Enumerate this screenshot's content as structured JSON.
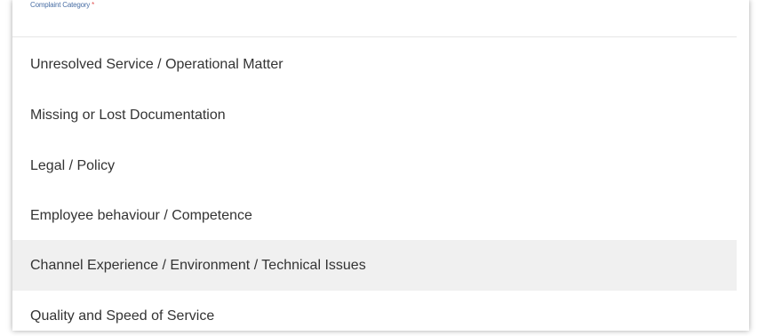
{
  "field": {
    "label": "Complaint Category",
    "required_marker": "*"
  },
  "dropdown": {
    "options": [
      {
        "label": "Unresolved Service / Operational Matter"
      },
      {
        "label": "Missing or Lost Documentation"
      },
      {
        "label": "Legal / Policy"
      },
      {
        "label": "Employee behaviour / Competence"
      },
      {
        "label": "Channel Experience / Environment / Technical Issues"
      },
      {
        "label": "Quality and Speed of Service"
      }
    ],
    "hovered_index": 4
  },
  "colors": {
    "label_blue": "#4a6fa5",
    "required_red": "#e05050",
    "hover_bg": "#f0f0f0",
    "option_text": "#333333"
  }
}
